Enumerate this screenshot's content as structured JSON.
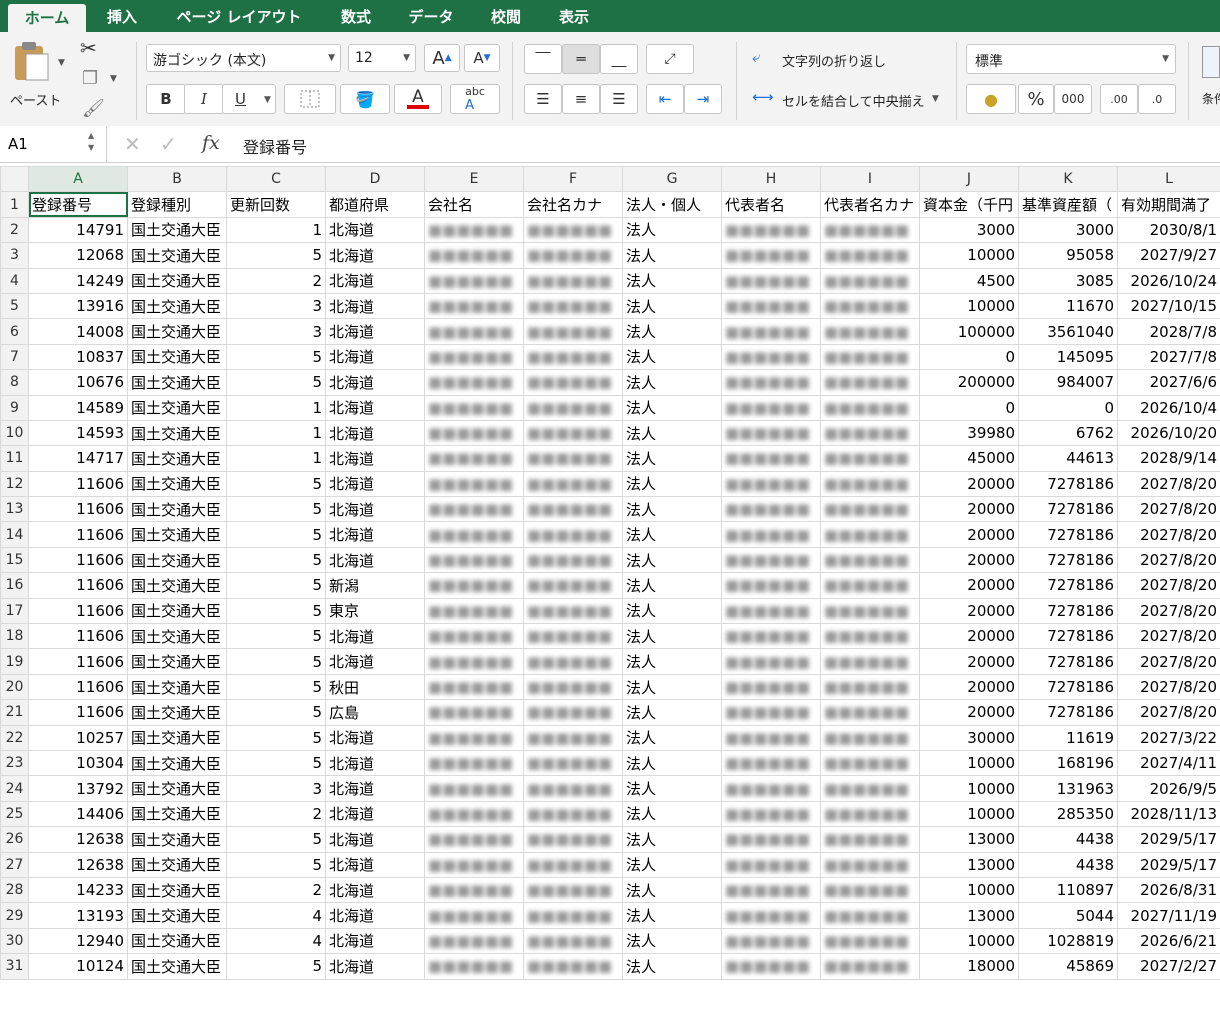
{
  "tabs": [
    "ホーム",
    "挿入",
    "ページ レイアウト",
    "数式",
    "データ",
    "校閲",
    "表示"
  ],
  "ribbon": {
    "paste_label": "ペースト",
    "font_name": "游ゴシック (本文)",
    "font_size": "12",
    "bold": "B",
    "italic": "I",
    "underline": "U",
    "font_grow": "A",
    "font_shrink": "A",
    "wrap_text": "文字列の折り返し",
    "merge_center": "セルを結合して中央揃え",
    "number_format": "標準",
    "percent": "%",
    "comma": "000",
    "inc_decimal": ".00",
    "dec_decimal": ".0",
    "conditional": "条件"
  },
  "formula_bar": {
    "name_box": "A1",
    "fx": "fx",
    "content": "登録番号"
  },
  "sheet": {
    "columns": [
      "A",
      "B",
      "C",
      "D",
      "E",
      "F",
      "G",
      "H",
      "I",
      "J",
      "K",
      "L"
    ],
    "header_row": [
      "登録番号",
      "登録種別",
      "更新回数",
      "都道府県",
      "会社名",
      "会社名カナ",
      "法人・個人",
      "代表者名",
      "代表者名カナ",
      "資本金（千円",
      "基準資産額（",
      "有効期間満了"
    ],
    "rows": [
      [
        "14791",
        "国土交通大臣",
        "1",
        "北海道",
        "",
        "",
        "法人",
        "",
        "",
        "3000",
        "3000",
        "2030/8/1"
      ],
      [
        "12068",
        "国土交通大臣",
        "5",
        "北海道",
        "",
        "",
        "法人",
        "",
        "",
        "10000",
        "95058",
        "2027/9/27"
      ],
      [
        "14249",
        "国土交通大臣",
        "2",
        "北海道",
        "",
        "",
        "法人",
        "",
        "",
        "4500",
        "3085",
        "2026/10/24"
      ],
      [
        "13916",
        "国土交通大臣",
        "3",
        "北海道",
        "",
        "",
        "法人",
        "",
        "",
        "10000",
        "11670",
        "2027/10/15"
      ],
      [
        "14008",
        "国土交通大臣",
        "3",
        "北海道",
        "",
        "",
        "法人",
        "",
        "",
        "100000",
        "3561040",
        "2028/7/8"
      ],
      [
        "10837",
        "国土交通大臣",
        "5",
        "北海道",
        "",
        "",
        "法人",
        "",
        "",
        "0",
        "145095",
        "2027/7/8"
      ],
      [
        "10676",
        "国土交通大臣",
        "5",
        "北海道",
        "",
        "",
        "法人",
        "",
        "",
        "200000",
        "984007",
        "2027/6/6"
      ],
      [
        "14589",
        "国土交通大臣",
        "1",
        "北海道",
        "",
        "",
        "法人",
        "",
        "",
        "0",
        "0",
        "2026/10/4"
      ],
      [
        "14593",
        "国土交通大臣",
        "1",
        "北海道",
        "",
        "",
        "法人",
        "",
        "",
        "39980",
        "6762",
        "2026/10/20"
      ],
      [
        "14717",
        "国土交通大臣",
        "1",
        "北海道",
        "",
        "",
        "法人",
        "",
        "",
        "45000",
        "44613",
        "2028/9/14"
      ],
      [
        "11606",
        "国土交通大臣",
        "5",
        "北海道",
        "",
        "",
        "法人",
        "",
        "",
        "20000",
        "7278186",
        "2027/8/20"
      ],
      [
        "11606",
        "国土交通大臣",
        "5",
        "北海道",
        "",
        "",
        "法人",
        "",
        "",
        "20000",
        "7278186",
        "2027/8/20"
      ],
      [
        "11606",
        "国土交通大臣",
        "5",
        "北海道",
        "",
        "",
        "法人",
        "",
        "",
        "20000",
        "7278186",
        "2027/8/20"
      ],
      [
        "11606",
        "国土交通大臣",
        "5",
        "北海道",
        "",
        "",
        "法人",
        "",
        "",
        "20000",
        "7278186",
        "2027/8/20"
      ],
      [
        "11606",
        "国土交通大臣",
        "5",
        "新潟",
        "",
        "",
        "法人",
        "",
        "",
        "20000",
        "7278186",
        "2027/8/20"
      ],
      [
        "11606",
        "国土交通大臣",
        "5",
        "東京",
        "",
        "",
        "法人",
        "",
        "",
        "20000",
        "7278186",
        "2027/8/20"
      ],
      [
        "11606",
        "国土交通大臣",
        "5",
        "北海道",
        "",
        "",
        "法人",
        "",
        "",
        "20000",
        "7278186",
        "2027/8/20"
      ],
      [
        "11606",
        "国土交通大臣",
        "5",
        "北海道",
        "",
        "",
        "法人",
        "",
        "",
        "20000",
        "7278186",
        "2027/8/20"
      ],
      [
        "11606",
        "国土交通大臣",
        "5",
        "秋田",
        "",
        "",
        "法人",
        "",
        "",
        "20000",
        "7278186",
        "2027/8/20"
      ],
      [
        "11606",
        "国土交通大臣",
        "5",
        "広島",
        "",
        "",
        "法人",
        "",
        "",
        "20000",
        "7278186",
        "2027/8/20"
      ],
      [
        "10257",
        "国土交通大臣",
        "5",
        "北海道",
        "",
        "",
        "法人",
        "",
        "",
        "30000",
        "11619",
        "2027/3/22"
      ],
      [
        "10304",
        "国土交通大臣",
        "5",
        "北海道",
        "",
        "",
        "法人",
        "",
        "",
        "10000",
        "168196",
        "2027/4/11"
      ],
      [
        "13792",
        "国土交通大臣",
        "3",
        "北海道",
        "",
        "",
        "法人",
        "",
        "",
        "10000",
        "131963",
        "2026/9/5"
      ],
      [
        "14406",
        "国土交通大臣",
        "2",
        "北海道",
        "",
        "",
        "法人",
        "",
        "",
        "10000",
        "285350",
        "2028/11/13"
      ],
      [
        "12638",
        "国土交通大臣",
        "5",
        "北海道",
        "",
        "",
        "法人",
        "",
        "",
        "13000",
        "4438",
        "2029/5/17"
      ],
      [
        "12638",
        "国土交通大臣",
        "5",
        "北海道",
        "",
        "",
        "法人",
        "",
        "",
        "13000",
        "4438",
        "2029/5/17"
      ],
      [
        "14233",
        "国土交通大臣",
        "2",
        "北海道",
        "",
        "",
        "法人",
        "",
        "",
        "10000",
        "110897",
        "2026/8/31"
      ],
      [
        "13193",
        "国土交通大臣",
        "4",
        "北海道",
        "",
        "",
        "法人",
        "",
        "",
        "13000",
        "5044",
        "2027/11/19"
      ],
      [
        "12940",
        "国土交通大臣",
        "4",
        "北海道",
        "",
        "",
        "法人",
        "",
        "",
        "10000",
        "1028819",
        "2026/6/21"
      ],
      [
        "10124",
        "国土交通大臣",
        "5",
        "北海道",
        "",
        "",
        "法人",
        "",
        "",
        "18000",
        "45869",
        "2027/2/27"
      ]
    ],
    "colors": {
      "accent": "#1e7145",
      "header_bg": "#f2f2f2",
      "gridline": "#d9d9d9"
    }
  }
}
